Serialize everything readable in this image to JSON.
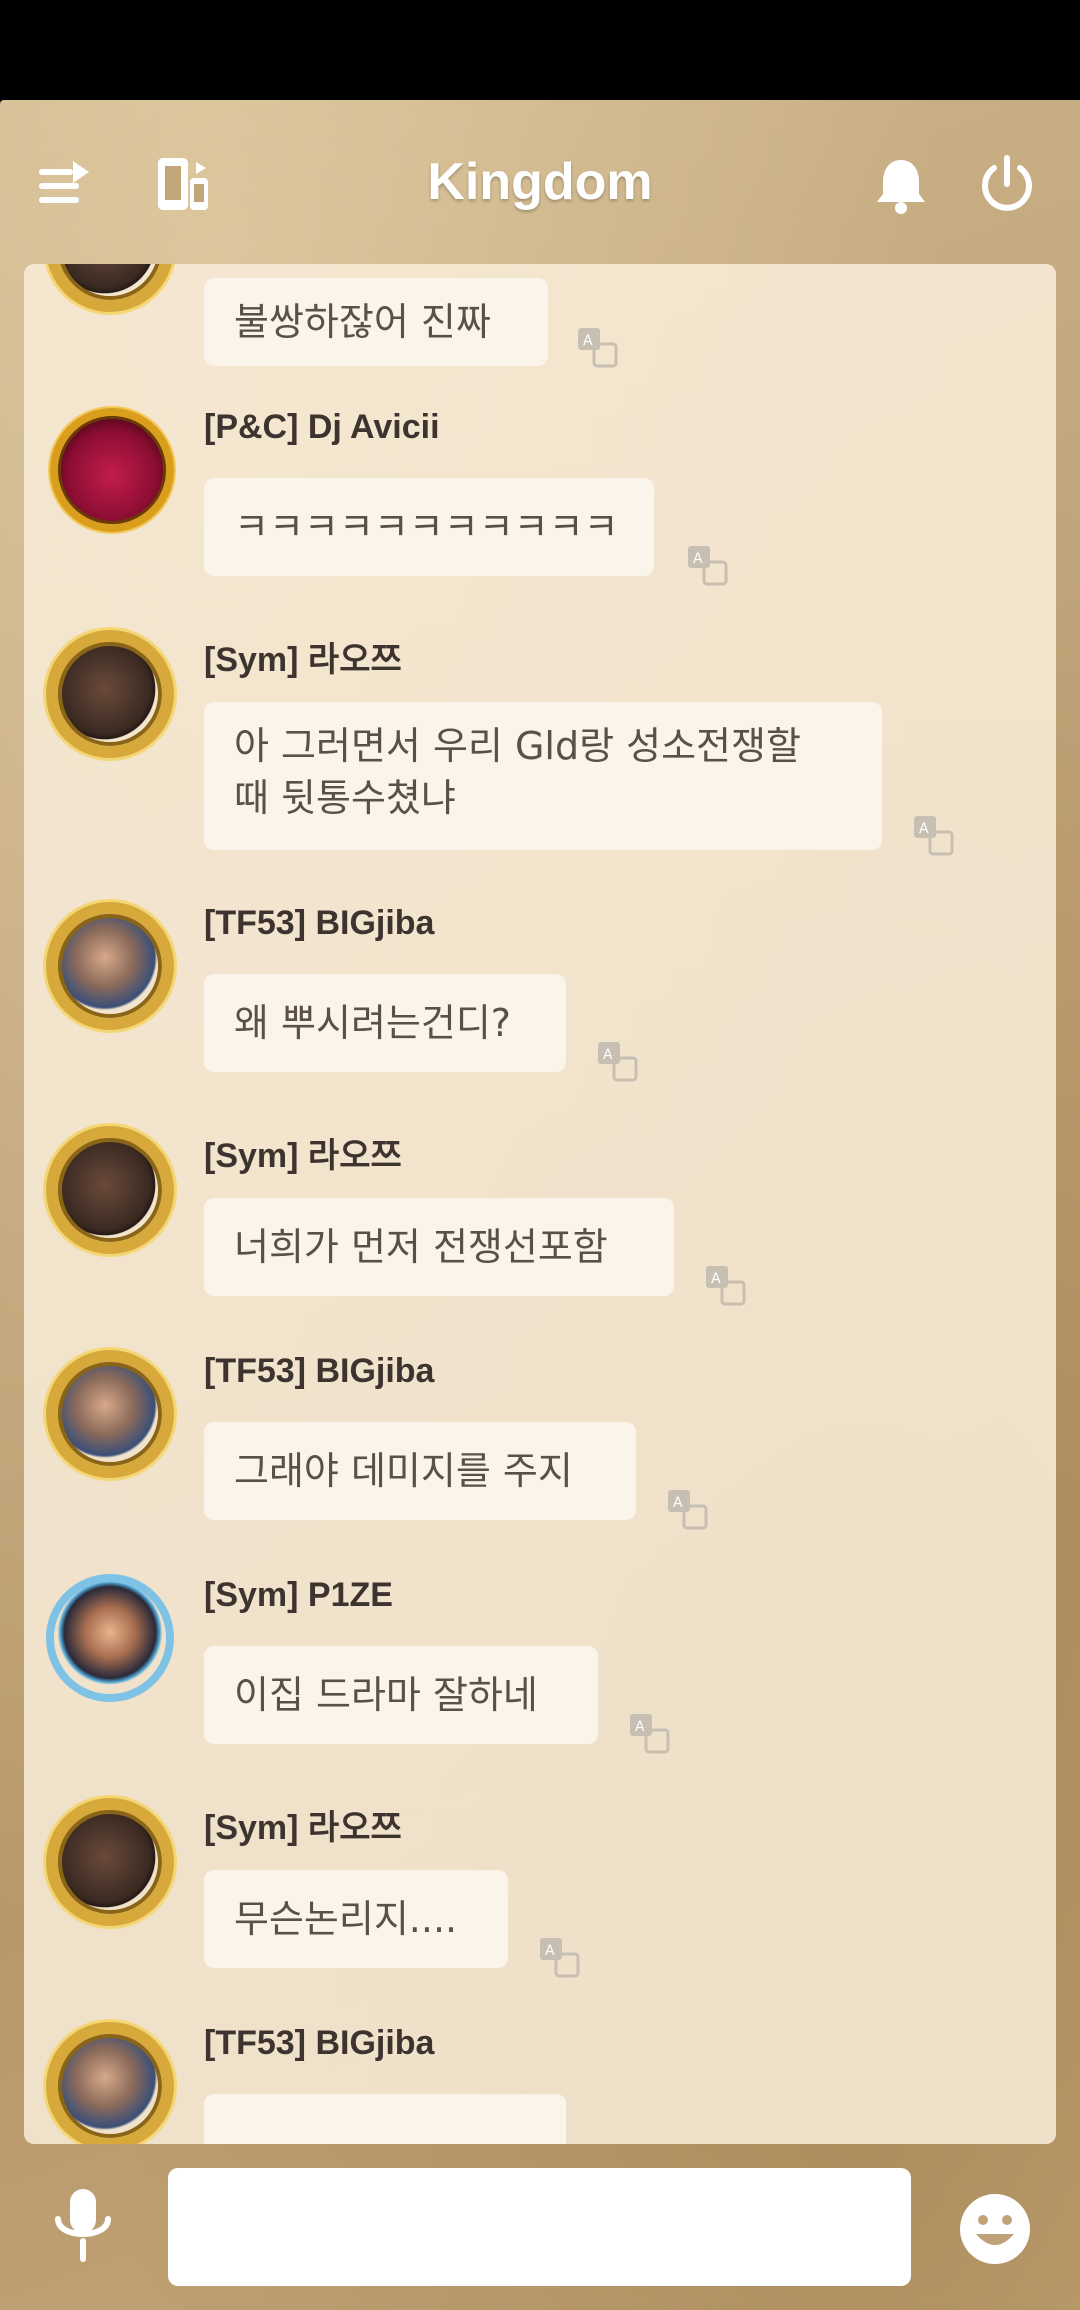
{
  "header": {
    "title": "Kingdom",
    "icons": [
      "switch-channel-icon",
      "device-link-icon",
      "bell-icon",
      "power-icon"
    ]
  },
  "colors": {
    "frame": "#bfa277",
    "panel": "#f4e7d2",
    "bubble": "#fbf4ea",
    "author_text": "#3d3430",
    "message_text": "#5b4f49"
  },
  "messages": [
    {
      "author": "",
      "text": "불쌍하잖어 진짜",
      "avatar": "gold-frame-avatar"
    },
    {
      "author": "[P&C] Dj Avicii",
      "text": "ㅋㅋㅋㅋㅋㅋㅋㅋㅋㅋㅋ",
      "avatar": "red-orb-avatar"
    },
    {
      "author": "[Sym] 라오쯔",
      "text_line1": "아 그러면서 우리 Gld랑 성소전쟁할",
      "text_line2": "때 뒷통수쳤냐",
      "avatar": "gold-frame-avatar"
    },
    {
      "author": "[TF53] BIGjiba",
      "text": "왜 뿌시려는건디?",
      "avatar": "gold-frame-avatar"
    },
    {
      "author": "[Sym] 라오쯔",
      "text": "너희가 먼저 전쟁선포함",
      "avatar": "gold-frame-avatar"
    },
    {
      "author": "[TF53] BIGjiba",
      "text": "그래야 데미지를 주지",
      "avatar": "gold-frame-avatar"
    },
    {
      "author": "[Sym] P1ZE",
      "text": "이집 드라마 잘하네",
      "avatar": "fairy-avatar"
    },
    {
      "author": "[Sym] 라오쯔",
      "text": "무슨논리지....",
      "avatar": "gold-frame-avatar"
    },
    {
      "author": "[TF53] BIGjiba",
      "text": "",
      "avatar": "gold-frame-avatar"
    }
  ],
  "input": {
    "value": "",
    "placeholder": ""
  }
}
